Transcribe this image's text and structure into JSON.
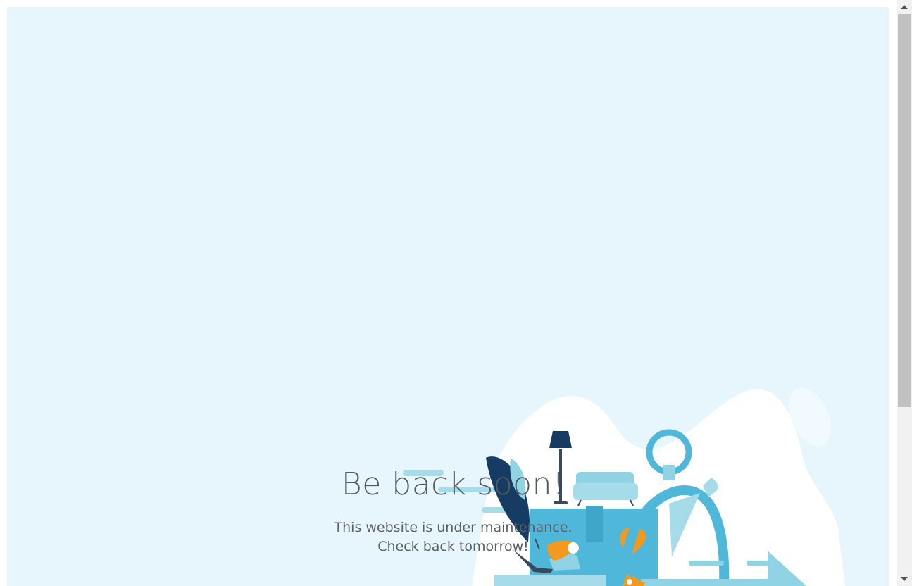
{
  "page": {
    "title": "Be back soon!",
    "message_line1": "This website is under maintenance.",
    "message_line2": "Check back tomorrow!"
  },
  "colors": {
    "background": "#e6f6fc",
    "blob": "#ffffff",
    "light_blue": "#8fd3e4",
    "mid_blue": "#4fb7d9",
    "navy": "#173c63",
    "orange": "#f39a1e"
  },
  "scrollbar": {
    "up_icon": "triangle-up",
    "down_icon": "triangle-down"
  }
}
